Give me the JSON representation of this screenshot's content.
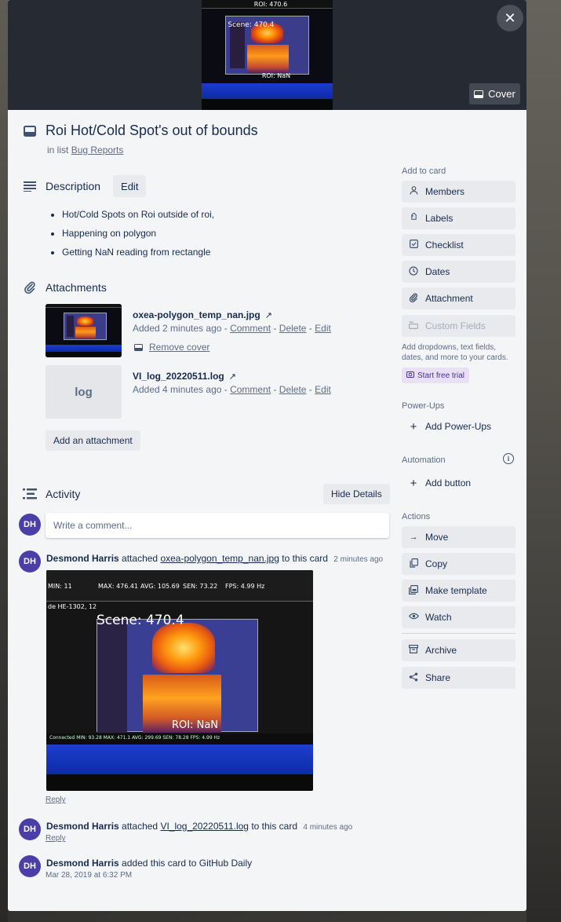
{
  "cover": {
    "button_label": "Cover",
    "close_glyph": "✕",
    "image_texts": {
      "roi": "ROI: 470.6",
      "scene": "Scene: 470.4",
      "roi_nan": "ROI: NaN"
    }
  },
  "card": {
    "title": "Roi Hot/Cold Spot's out of bounds",
    "list_prefix": "in list",
    "list_name": "Bug Reports"
  },
  "description": {
    "heading": "Description",
    "edit_label": "Edit",
    "items": [
      "Hot/Cold Spots on Roi outside of roi,",
      "Happening on polygon",
      "Getting NaN reading from rectangle"
    ]
  },
  "attachments": {
    "heading": "Attachments",
    "items": [
      {
        "name": "oxea-polygon_temp_nan.jpg",
        "arrow": "↗",
        "added": "Added 2 minutes ago",
        "sep": " - ",
        "comment": "Comment",
        "delete": "Delete",
        "edit": "Edit",
        "remove_cover": "Remove cover"
      },
      {
        "name": "VI_log_20220511.log",
        "arrow": "↗",
        "thumb_label": "log",
        "added": "Added 4 minutes ago",
        "sep": " - ",
        "comment": "Comment",
        "delete": "Delete",
        "edit": "Edit"
      }
    ],
    "add_label": "Add an attachment"
  },
  "activity": {
    "heading": "Activity",
    "hide_label": "Hide Details",
    "avatar_initials": "DH",
    "comment_placeholder": "Write a comment...",
    "entries": [
      {
        "user": "Desmond Harris",
        "action": "attached",
        "link": "oxea-polygon_temp_nan.jpg",
        "suffix": "to this card",
        "time": "2 minutes ago",
        "reply": "Reply"
      },
      {
        "user": "Desmond Harris",
        "action": "attached",
        "link": "VI_log_20220511.log",
        "suffix": "to this card",
        "time": "4 minutes ago",
        "reply": "Reply"
      },
      {
        "user": "Desmond Harris",
        "action": "added this card to GitHub Daily",
        "date": "Mar 28, 2019 at 6:32 PM"
      }
    ],
    "image_texts": {
      "min": "MIN: 11",
      "max": "MAX: 476.41",
      "avg": "AVG: 105.69",
      "sen": "SEN: 73.22",
      "fps": "FPS: 4.99 Hz",
      "device": "de HE-1302, 12",
      "scene": "Scene: 470.4",
      "roi": "ROI: NaN",
      "status": "Connected  MIN: 93.28   MAX: 471.1   AVG: 299.69   SEN: 78.28  FPS: 4.99 Hz"
    }
  },
  "sidebar": {
    "add_to_card": "Add to card",
    "add_items": [
      {
        "label": "Members",
        "icon": "person-icon"
      },
      {
        "label": "Labels",
        "icon": "tag-icon"
      },
      {
        "label": "Checklist",
        "icon": "checkbox-icon"
      },
      {
        "label": "Dates",
        "icon": "clock-icon"
      },
      {
        "label": "Attachment",
        "icon": "paperclip-icon"
      },
      {
        "label": "Custom Fields",
        "icon": "fields-icon"
      }
    ],
    "promo_text": "Add dropdowns, text fields, dates, and more to your cards.",
    "trial_label": "Start free trial",
    "powerups_label": "Power-Ups",
    "add_powerups": "Add Power-Ups",
    "automation_label": "Automation",
    "add_button": "Add button",
    "actions_label": "Actions",
    "actions": [
      {
        "label": "Move",
        "icon": "arrow-right-icon"
      },
      {
        "label": "Copy",
        "icon": "copy-icon"
      },
      {
        "label": "Make template",
        "icon": "template-icon"
      },
      {
        "label": "Watch",
        "icon": "eye-icon"
      },
      {
        "label": "Archive",
        "icon": "archive-icon"
      },
      {
        "label": "Share",
        "icon": "share-icon"
      }
    ]
  }
}
